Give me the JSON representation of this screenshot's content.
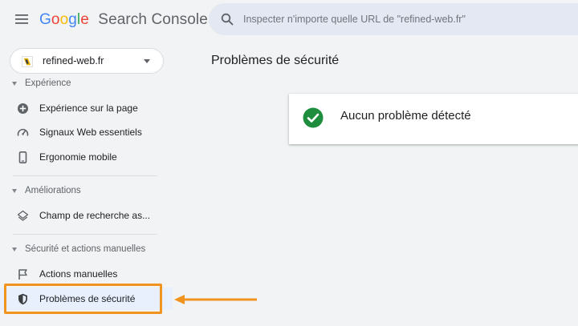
{
  "header": {
    "logo_letters": [
      {
        "char": "G",
        "color": "#4285f4"
      },
      {
        "char": "o",
        "color": "#ea4335"
      },
      {
        "char": "o",
        "color": "#fbbc05"
      },
      {
        "char": "g",
        "color": "#4285f4"
      },
      {
        "char": "l",
        "color": "#34a853"
      },
      {
        "char": "e",
        "color": "#ea4335"
      }
    ],
    "product_name": "Search Console",
    "search_placeholder": "Inspecter n'importe quelle URL de \"refined-web.fr\""
  },
  "property": {
    "name": "refined-web.fr"
  },
  "sidebar": {
    "sections": [
      {
        "title": "Expérience",
        "items": [
          {
            "label": "Expérience sur la page",
            "icon": "plus-circle-icon"
          },
          {
            "label": "Signaux Web essentiels",
            "icon": "speedometer-icon"
          },
          {
            "label": "Ergonomie mobile",
            "icon": "smartphone-icon"
          }
        ]
      },
      {
        "title": "Améliorations",
        "items": [
          {
            "label": "Champ de recherche as...",
            "icon": "layers-icon"
          }
        ]
      },
      {
        "title": "Sécurité et actions manuelles",
        "items": [
          {
            "label": "Actions manuelles",
            "icon": "flag-icon"
          },
          {
            "label": "Problèmes de sécurité",
            "icon": "shield-icon",
            "active": true
          }
        ]
      }
    ]
  },
  "main": {
    "page_title": "Problèmes de sécurité",
    "status_card_text": "Aucun problème détecté"
  },
  "colors": {
    "highlight": "#f0941f",
    "success": "#1e8e3e",
    "active_bg": "#e8f0fe"
  }
}
